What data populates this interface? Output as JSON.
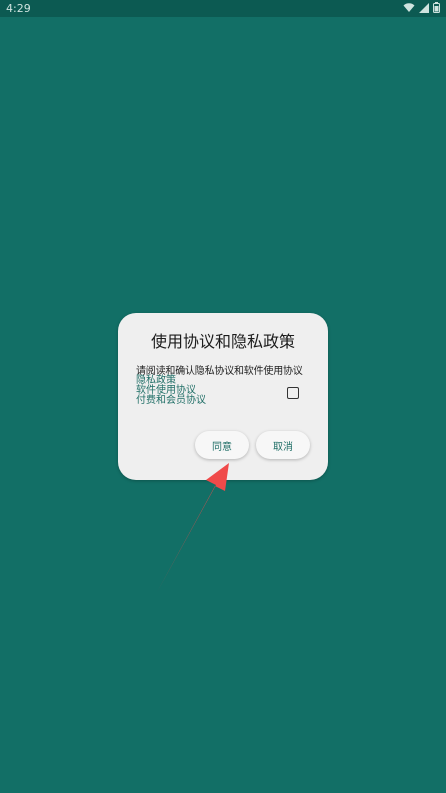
{
  "status_bar": {
    "time": "4:29",
    "icons": [
      "wifi-icon",
      "cellular-signal-icon",
      "battery-icon"
    ]
  },
  "dialog": {
    "title": "使用协议和隐私政策",
    "description": "请阅读和确认隐私协议和软件使用协议",
    "links": [
      {
        "label": "隐私政策"
      },
      {
        "label": "软件使用协议"
      },
      {
        "label": "付费和会员协议"
      }
    ],
    "checkbox_checked": false,
    "agree_label": "同意",
    "cancel_label": "取消"
  },
  "colors": {
    "background": "#126f66",
    "status_bar": "#0c5a52",
    "dialog_bg": "#efefef",
    "accent": "#1f6e66",
    "annotation_arrow": "#f04a4a"
  },
  "annotation": {
    "icon": "red-arrow-icon"
  }
}
